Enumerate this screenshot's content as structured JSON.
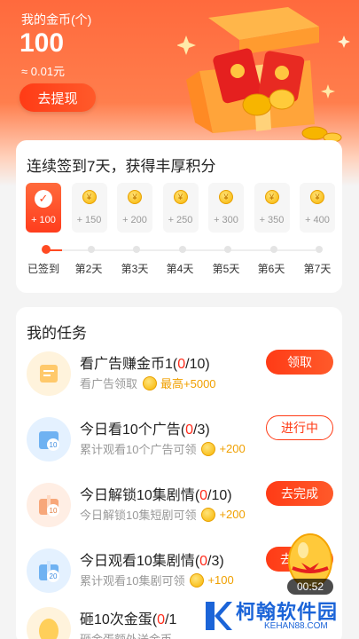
{
  "wallet": {
    "title": "我的金币(个)",
    "amount": "100",
    "rmb": "≈ 0.01元",
    "withdraw_label": "去提现"
  },
  "signin": {
    "title": "连续签到7天，获得丰厚积分",
    "days": [
      {
        "value": "+ 100",
        "label": "已签到",
        "done": true
      },
      {
        "value": "+ 150",
        "label": "第2天",
        "done": false
      },
      {
        "value": "+ 200",
        "label": "第3天",
        "done": false
      },
      {
        "value": "+ 250",
        "label": "第4天",
        "done": false
      },
      {
        "value": "+ 300",
        "label": "第5天",
        "done": false
      },
      {
        "value": "+ 350",
        "label": "第6天",
        "done": false
      },
      {
        "value": "+ 400",
        "label": "第7天",
        "done": false
      }
    ],
    "coin_glyph": "¥"
  },
  "tasks": {
    "title": "我的任务",
    "items": [
      {
        "name": "看广告赚金币1",
        "open": "(",
        "progress": "0",
        "rest": "/10)",
        "desc": "看广告领取",
        "reward": "最高+5000",
        "button": "领取",
        "button_style": "solid",
        "icon": "ad-icon"
      },
      {
        "name": "今日看10个广告",
        "open": "(",
        "progress": "0",
        "rest": "/3)",
        "desc": "累计观看10个广告可领",
        "reward": "+200",
        "button": "进行中",
        "button_style": "outline",
        "icon": "gift-10-icon"
      },
      {
        "name": "今日解锁10集剧情",
        "open": "(",
        "progress": "0",
        "rest": "/10)",
        "desc": "今日解锁10集短剧可领",
        "reward": "+200",
        "button": "去完成",
        "button_style": "solid",
        "icon": "gift-10-icon"
      },
      {
        "name": "今日观看10集剧情",
        "open": "(",
        "progress": "0",
        "rest": "/3)",
        "desc": "累计观看10集剧可领",
        "reward": "+100",
        "button": "去",
        "button_style": "solid",
        "icon": "gift-20-icon"
      },
      {
        "name": "砸10次金蛋",
        "open": "(",
        "progress": "0",
        "rest": "/1",
        "desc": "砸金蛋额外送金币",
        "reward": "",
        "button": "",
        "button_style": "none",
        "icon": "egg-icon"
      }
    ]
  },
  "floating": {
    "timer": "00:52"
  },
  "watermark": {
    "text": "柯翰软件园",
    "sub": "KEHAN88.COM"
  },
  "colors": {
    "accent": "#ff3b16",
    "header": "#ff6a3d",
    "coin": "#f7b500",
    "watermark": "#1b64d8"
  }
}
